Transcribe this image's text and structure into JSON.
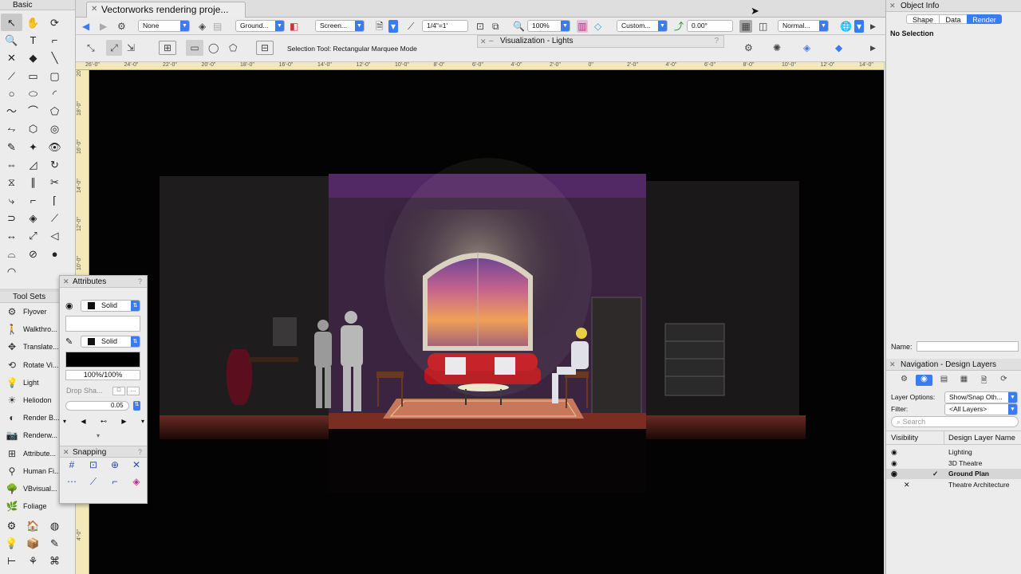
{
  "window": {
    "tab_title": "Vectorworks rendering proje..."
  },
  "basic_palette": {
    "title": "Basic",
    "tools": [
      {
        "icon": "selection-arrow-icon",
        "glyph": "↖",
        "selected": true
      },
      {
        "icon": "pan-hand-icon",
        "glyph": "✋"
      },
      {
        "icon": "flyover-icon",
        "glyph": "⟳"
      },
      {
        "icon": "zoom-icon",
        "glyph": "🔍"
      },
      {
        "icon": "text-icon",
        "glyph": "T"
      },
      {
        "icon": "callout-icon",
        "glyph": "⌐"
      },
      {
        "icon": "x-icon",
        "glyph": "✕"
      },
      {
        "icon": "attribute-mapping-icon",
        "glyph": "◆"
      },
      {
        "icon": "line-icon",
        "glyph": "╲"
      },
      {
        "icon": "double-line-icon",
        "glyph": "⟋"
      },
      {
        "icon": "rectangle-icon",
        "glyph": "▭"
      },
      {
        "icon": "rounded-rect-icon",
        "glyph": "▢"
      },
      {
        "icon": "circle-icon",
        "glyph": "○"
      },
      {
        "icon": "oval-icon",
        "glyph": "⬭"
      },
      {
        "icon": "arc-icon",
        "glyph": "◜"
      },
      {
        "icon": "freehand-icon",
        "glyph": "〜"
      },
      {
        "icon": "polyline-icon",
        "glyph": "⌒"
      },
      {
        "icon": "polygon-icon",
        "glyph": "⬠"
      },
      {
        "icon": "double-polyline-icon",
        "glyph": "⥊"
      },
      {
        "icon": "regular-polygon-icon",
        "glyph": "⬡"
      },
      {
        "icon": "spiral-icon",
        "glyph": "◎"
      },
      {
        "icon": "eyedropper-icon",
        "glyph": "✎"
      },
      {
        "icon": "magic-wand-icon",
        "glyph": "✦"
      },
      {
        "icon": "visibility-icon",
        "glyph": "👁"
      },
      {
        "icon": "move-icon",
        "glyph": "⇔"
      },
      {
        "icon": "fillet-icon",
        "glyph": "◿"
      },
      {
        "icon": "rotate-icon",
        "glyph": "↻"
      },
      {
        "icon": "mirror-icon",
        "glyph": "⧖"
      },
      {
        "icon": "offset-icon",
        "glyph": "∥"
      },
      {
        "icon": "trim-icon",
        "glyph": "✂"
      },
      {
        "icon": "connect-icon",
        "glyph": "⤷"
      },
      {
        "icon": "chamfer-icon",
        "glyph": "⌐"
      },
      {
        "icon": "clip-icon",
        "glyph": "⌈"
      },
      {
        "icon": "reshape-icon",
        "glyph": "⊃"
      },
      {
        "icon": "shape-paint-icon",
        "glyph": "◈"
      },
      {
        "icon": "split-icon",
        "glyph": "⟋"
      },
      {
        "icon": "dimension-icon",
        "glyph": "↔"
      },
      {
        "icon": "constrained-dim-icon",
        "glyph": "⤢"
      },
      {
        "icon": "angular-dim-icon",
        "glyph": "◁"
      },
      {
        "icon": "path-icon",
        "glyph": "⌓"
      },
      {
        "icon": "compass-icon",
        "glyph": "⊘"
      },
      {
        "icon": "light-bulb-icon",
        "glyph": "●"
      },
      {
        "icon": "protractor-icon",
        "glyph": "◠"
      }
    ]
  },
  "tool_sets": {
    "title": "Tool Sets",
    "items": [
      {
        "icon": "flyover-icon",
        "glyph": "⚙",
        "label": "Flyover"
      },
      {
        "icon": "walkthrough-icon",
        "glyph": "🚶",
        "label": "Walkthro..."
      },
      {
        "icon": "translate-icon",
        "glyph": "✥",
        "label": "Translate..."
      },
      {
        "icon": "rotate-view-icon",
        "glyph": "⟲",
        "label": "Rotate Vi..."
      },
      {
        "icon": "light-icon",
        "glyph": "💡",
        "label": "Light"
      },
      {
        "icon": "heliodon-icon",
        "glyph": "☀",
        "label": "Heliodon"
      },
      {
        "icon": "render-bg-icon",
        "glyph": "◐",
        "label": "Render B..."
      },
      {
        "icon": "renderworks-camera-icon",
        "glyph": "📷",
        "label": "Renderw..."
      },
      {
        "icon": "attribute-icon",
        "glyph": "⊞",
        "label": "Attribute..."
      },
      {
        "icon": "human-figure-icon",
        "glyph": "⚲",
        "label": "Human Fi..."
      },
      {
        "icon": "vbvisual-icon",
        "glyph": "🌳",
        "label": "VBvisual..."
      },
      {
        "icon": "foliage-icon",
        "glyph": "🌿",
        "label": "Foliage"
      }
    ],
    "grid": [
      "⚙",
      "🏠",
      "◍",
      "💡",
      "📦",
      "✎",
      "⊢",
      "⚘",
      "⌘"
    ]
  },
  "view_bar": {
    "class": "None",
    "layer": "Ground...",
    "render_mode": "Screen...",
    "scale": "1/4\"=1'",
    "zoom": "100%",
    "view": "Custom...",
    "rotation": "0.00°",
    "projection": "Normal..."
  },
  "mode_bar": {
    "text": "Selection Tool: Rectangular Marquee Mode"
  },
  "visualization": {
    "title": "Visualization - Lights"
  },
  "ruler": {
    "h_labels": [
      "26'-0\"",
      "24'-0\"",
      "22'-0\"",
      "20'-0\"",
      "18'-0\"",
      "16'-0\"",
      "14'-0\"",
      "12'-0\"",
      "10'-0\"",
      "8'-0\"",
      "6'-0\"",
      "4'-0\"",
      "2'-0\"",
      "0\"",
      "2'-0\"",
      "4'-0\"",
      "6'-0\"",
      "8'-0\"",
      "10'-0\"",
      "12'-0\"",
      "14'-0\""
    ],
    "v_labels": [
      "20'-0\"",
      "18'-0\"",
      "16'-0\"",
      "14'-0\"",
      "12'-0\"",
      "10'-0\"",
      "8'-0\"",
      "6'-0\"",
      "4'-0\"",
      "2'-0\"",
      "0\"",
      "2'-0\"",
      "4'-0\""
    ]
  },
  "object_info": {
    "title": "Object Info",
    "tabs": [
      "Shape",
      "Data",
      "Render"
    ],
    "active_tab": "Render",
    "selection": "No Selection",
    "name_label": "Name:"
  },
  "navigation": {
    "title": "Navigation - Design Layers",
    "layer_options_label": "Layer Options:",
    "layer_options_value": "Show/Snap Oth...",
    "filter_label": "Filter:",
    "filter_value": "<All Layers>",
    "search_placeholder": "Search",
    "col_visibility": "Visibility",
    "col_name": "Design Layer Name",
    "layers": [
      {
        "name": "Lighting",
        "visible": "eye",
        "active": false
      },
      {
        "name": "3D Theatre",
        "visible": "eye",
        "active": false
      },
      {
        "name": "Ground Plan",
        "visible": "eye",
        "active": true
      },
      {
        "name": "Theatre Architecture",
        "visible": "hidden",
        "active": false
      }
    ]
  },
  "attributes": {
    "title": "Attributes",
    "fill_style": "Solid",
    "pen_style": "Solid",
    "opacity": "100%/100%",
    "drop_shadow_label": "Drop Sha...",
    "line_weight": "0.05"
  },
  "snapping": {
    "title": "Snapping"
  },
  "colors": {
    "accent": "#3a7bf0",
    "ruler": "#f3e9b8",
    "sofa": "#b5141c",
    "sky_top": "#7a3a8a",
    "sky_bottom": "#f0a040"
  }
}
